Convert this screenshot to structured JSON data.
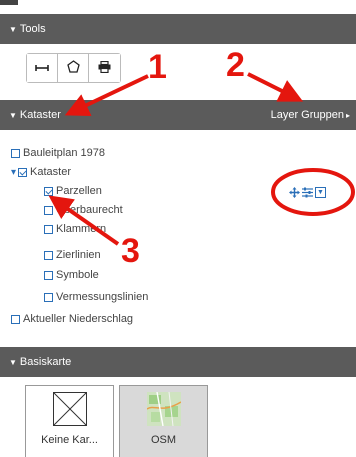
{
  "panels": {
    "tools": {
      "title": "Tools",
      "buttons": [
        {
          "name": "measure-line",
          "glyph": "⟷"
        },
        {
          "name": "measure-area",
          "glyph": "⬠"
        },
        {
          "name": "print",
          "glyph": "🖶"
        }
      ]
    },
    "kataster": {
      "title": "Kataster",
      "right_label": "Layer Gruppen",
      "layers": [
        {
          "label": "Bauleitplan 1978",
          "checked": false
        },
        {
          "label": "Kataster",
          "checked": true,
          "expanded": true
        },
        {
          "label": "Parzellen",
          "checked": true
        },
        {
          "label": "Überbaurecht",
          "checked": false
        },
        {
          "label": "Klammern",
          "checked": false
        },
        {
          "label": "Zierlinien",
          "checked": false
        },
        {
          "label": "Symbole",
          "checked": false
        },
        {
          "label": "Vermessungslinien",
          "checked": false
        },
        {
          "label": "Aktueller Niederschlag",
          "checked": false
        }
      ]
    },
    "basiskarte": {
      "title": "Basiskarte",
      "tiles": [
        {
          "label": "Keine Kar..."
        },
        {
          "label": "OSM"
        }
      ]
    }
  },
  "annotations": {
    "callout_1": "1",
    "callout_2": "2",
    "callout_3": "3",
    "color": "#e4160e"
  },
  "colors": {
    "header_bg": "#5b5b5b",
    "checkbox_blue": "#2a6fb8"
  }
}
